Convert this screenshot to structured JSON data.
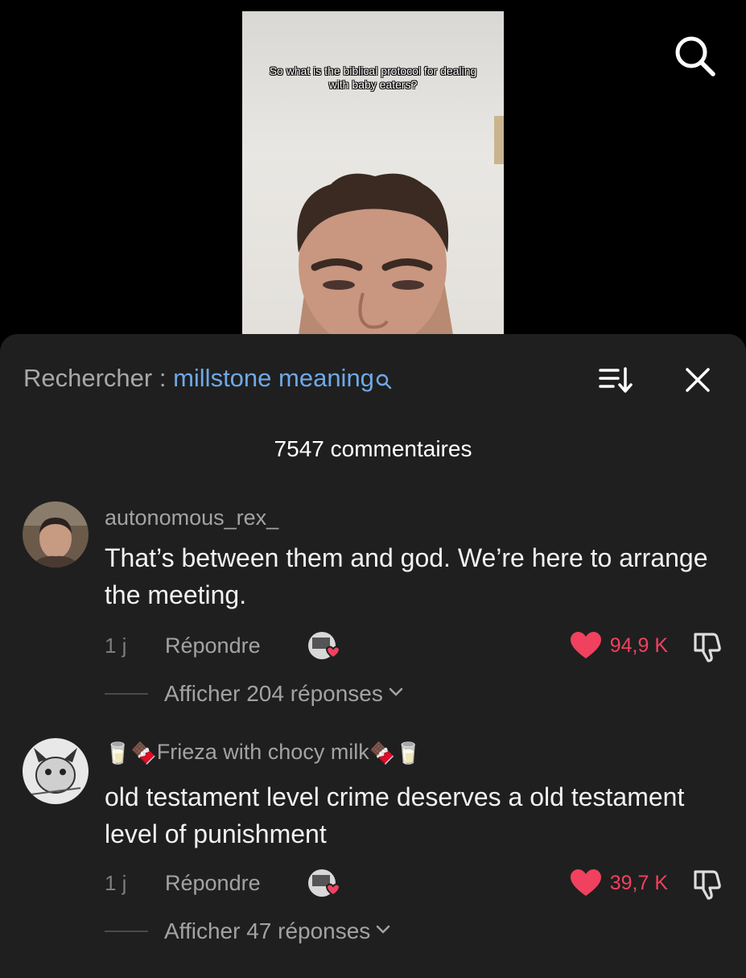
{
  "video": {
    "caption": "So what is the biblical protocol for dealing with baby eaters?"
  },
  "sheet": {
    "search_prefix": "Rechercher : ",
    "search_query": "millstone meaning",
    "comment_count": "7547 commentaires"
  },
  "comments": [
    {
      "username": "autonomous_rex_",
      "text": "That’s between them and god. We’re here to arrange the meeting.",
      "time": "1 j",
      "reply_label": "Répondre",
      "likes": "94,9 K",
      "replies_label": "Afficher 204 réponses"
    },
    {
      "username_emoji_left": "🥛🍫",
      "username": "Frieza with chocy milk",
      "username_emoji_right": "🍫🥛",
      "text": "old testament level crime deserves a old testament level of punishment",
      "time": "1 j",
      "reply_label": "Répondre",
      "likes": "39,7 K",
      "replies_label": "Afficher 47 réponses"
    }
  ],
  "colors": {
    "sheet_bg": "#1f1f1f",
    "accent_link": "#6fa8e8",
    "like_red": "#f0415f"
  },
  "icons": [
    "search-icon",
    "sort-icon",
    "close-icon",
    "heart-icon",
    "dislike-icon",
    "chevron-down-icon"
  ]
}
